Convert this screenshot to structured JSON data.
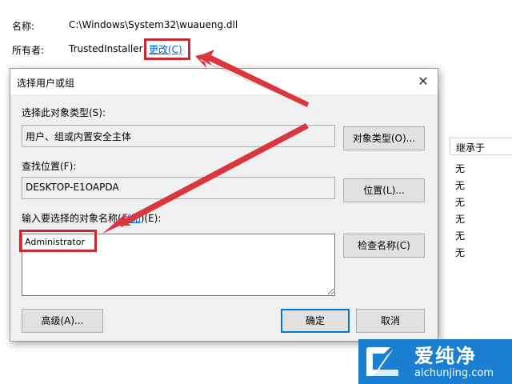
{
  "background": {
    "name_label": "名称:",
    "name_value": "C:\\Windows\\System32\\wuaueng.dll",
    "owner_label": "所有者:",
    "owner_value": "TrustedInstaller",
    "change_link": "更改(C)",
    "inherit_header": "继承于",
    "inherit_values": [
      "无",
      "无",
      "无",
      "无",
      "无",
      "无"
    ]
  },
  "dialog": {
    "title": "选择用户或组",
    "object_type_label": "选择此对象类型(S):",
    "object_type_value": "用户、组或内置安全主体",
    "object_type_button": "对象类型(O)...",
    "location_label": "查找位置(F):",
    "location_value": "DESKTOP-E1OAPDA",
    "location_button": "位置(L)...",
    "enter_names_label": "输入要选择的对象名称(",
    "examples_link": "例如",
    "enter_names_suffix": ")(E):",
    "names_input_value": "Administrator",
    "check_names_button": "检查名称(C)",
    "advanced_button": "高级(A)...",
    "ok_button": "确定",
    "cancel_button": "取消"
  },
  "watermark": {
    "brand": "爱纯净",
    "url": "aichunjing.com"
  },
  "colors": {
    "highlight": "#c8282e",
    "link": "#0066cc",
    "watermark_bg": "#1a7fd0"
  }
}
